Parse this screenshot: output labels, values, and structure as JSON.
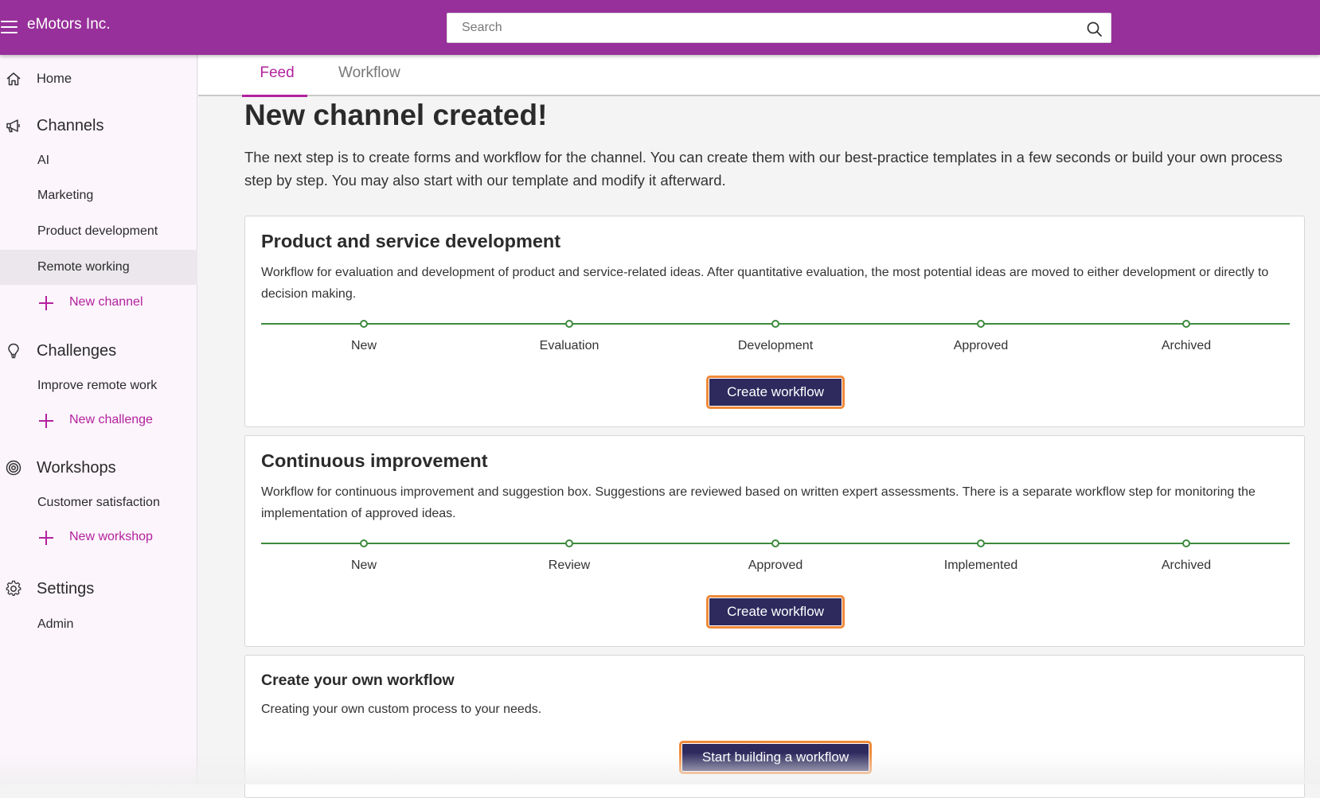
{
  "header": {
    "brand": "eMotors Inc.",
    "search_placeholder": "Search"
  },
  "sidebar": {
    "home": "Home",
    "channels": {
      "title": "Channels",
      "items": [
        "AI",
        "Marketing",
        "Product development",
        "Remote working"
      ],
      "selected": "Remote working",
      "new_label": "New channel"
    },
    "challenges": {
      "title": "Challenges",
      "items": [
        "Improve remote work"
      ],
      "new_label": "New challenge"
    },
    "workshops": {
      "title": "Workshops",
      "items": [
        "Customer satisfaction"
      ],
      "new_label": "New workshop"
    },
    "settings": {
      "title": "Settings",
      "items": [
        "Admin"
      ]
    }
  },
  "tabs": {
    "feed": "Feed",
    "workflow": "Workflow",
    "active": "Feed"
  },
  "main": {
    "title": "New channel created!",
    "intro": "The next step is to create forms and workflow for the channel. You can create them with our best-practice templates in a few seconds or build your own process step by step. You may also start with our template and modify it afterward.",
    "cards": [
      {
        "title": "Product and service development",
        "description": "Workflow for evaluation and development of product and service-related ideas. After quantitative evaluation, the most potential ideas are moved to either development or directly to decision making.",
        "steps": [
          "New",
          "Evaluation",
          "Development",
          "Approved",
          "Archived"
        ],
        "button": "Create workflow"
      },
      {
        "title": "Continuous improvement",
        "description": "Workflow for continuous improvement and suggestion box. Suggestions are reviewed based on written expert assessments. There is a separate workflow step for monitoring the implementation of approved ideas.",
        "steps": [
          "New",
          "Review",
          "Approved",
          "Implemented",
          "Archived"
        ],
        "button": "Create workflow"
      },
      {
        "title": "Create your own workflow",
        "description": "Creating your own custom process to your needs.",
        "button": "Start building a workflow"
      }
    ]
  },
  "colors": {
    "header_bg": "#97309a",
    "accent": "#b3219e",
    "button_bg": "#2e2a5e",
    "button_border": "#f08a3a",
    "timeline": "#3d8a3d"
  }
}
